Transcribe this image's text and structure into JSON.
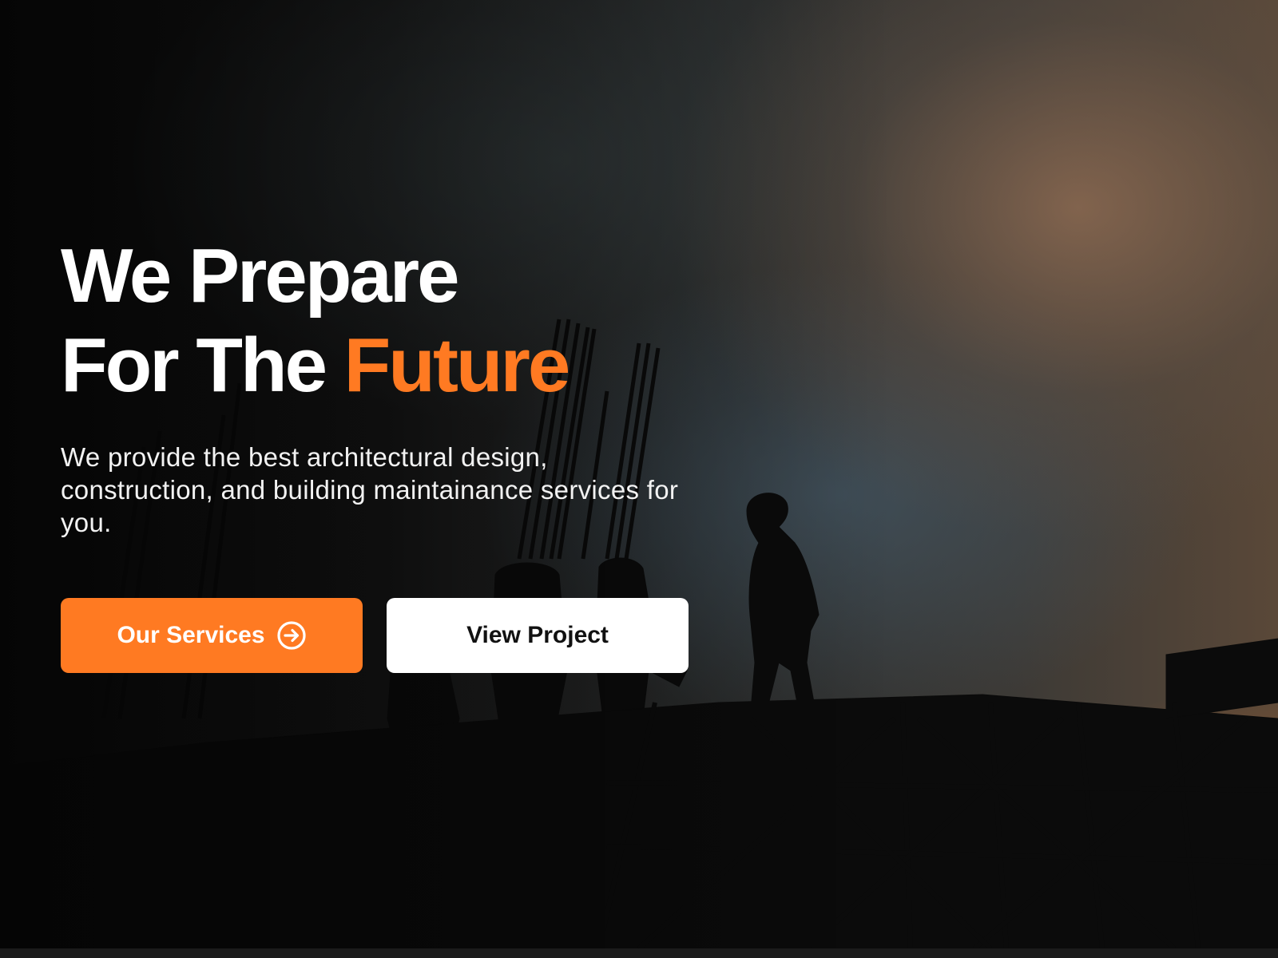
{
  "hero": {
    "title_line1": "We Prepare",
    "title_line2_prefix": "For The",
    "title_line2_accent": "Future",
    "description": "We provide the best architectural design, construction, and building maintainance services for you.",
    "primary_button": {
      "label": "Our Services",
      "icon": "arrow-right-circle-icon"
    },
    "secondary_button": {
      "label": "View Project"
    }
  },
  "colors": {
    "accent": "#ff7a22",
    "text": "#ffffff",
    "secondary_button_bg": "#ffffff",
    "secondary_button_text": "#111111"
  }
}
